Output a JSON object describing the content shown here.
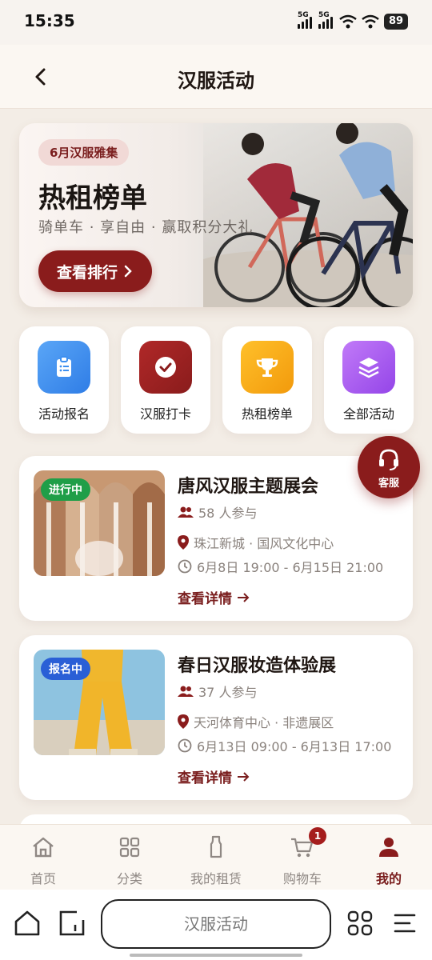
{
  "status": {
    "time": "15:35",
    "net1": "5G",
    "net2": "5G",
    "battery": "89"
  },
  "header": {
    "title": "汉服活动"
  },
  "banner": {
    "tag": "6月汉服雅集",
    "title": "热租榜单",
    "subtitle": "骑单车 · 享自由 · 赢取积分大礼",
    "cta": "查看排行"
  },
  "quick_links": [
    {
      "label": "活动报名",
      "icon": "clipboard-icon",
      "color": "#3d8ff0"
    },
    {
      "label": "汉服打卡",
      "icon": "check-circle-icon",
      "color": "#9a1f1f"
    },
    {
      "label": "热租榜单",
      "icon": "trophy-icon",
      "color": "#f5a50f"
    },
    {
      "label": "全部活动",
      "icon": "layers-icon",
      "color": "#a35af0"
    }
  ],
  "fab": {
    "label": "客服"
  },
  "events": [
    {
      "badge": "进行中",
      "badge_color": "#1f9e48",
      "title": "唐风汉服主题展会",
      "participants": "58 人参与",
      "location": "珠江新城 · 国风文化中心",
      "time": "6月8日 19:00 - 6月15日 21:00",
      "more": "查看详情"
    },
    {
      "badge": "报名中",
      "badge_color": "#2a5fd6",
      "title": "春日汉服妆造体验展",
      "participants": "37 人参与",
      "location": "天河体育中心 · 非遗展区",
      "time": "6月13日 09:00 - 6月13日 17:00",
      "more": "查看详情"
    }
  ],
  "tabs": [
    {
      "label": "首页",
      "icon": "home-icon"
    },
    {
      "label": "分类",
      "icon": "grid-icon"
    },
    {
      "label": "我的租赁",
      "icon": "garment-icon"
    },
    {
      "label": "购物车",
      "icon": "cart-icon",
      "badge": "1"
    },
    {
      "label": "我的",
      "icon": "user-icon",
      "active": true
    }
  ],
  "browser": {
    "address": "汉服活动"
  },
  "colors": {
    "brand": "#8a1c1c",
    "background": "#f3ede6"
  }
}
